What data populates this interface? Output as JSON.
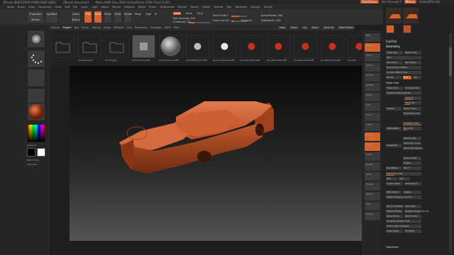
{
  "titlebar": {
    "app": "ZBrush 4R8[ZOSPB-PXNB-SNST-SKJD]",
    "doc": "ZBrush Document",
    "mem": "Mem 4996 Free 3941 ActivePoints 6784 Timer:0.011",
    "quicksave": "QuickSave",
    "seethrough": "See-through 0",
    "menus": "Menus",
    "defaultscript": "DefaultZScript"
  },
  "menubar": [
    "Alpha",
    "Brush",
    "Color",
    "Document",
    "Draw",
    "Edit",
    "File",
    "Layer",
    "Light",
    "Macro",
    "Marker",
    "Material",
    "Movie",
    "Picker",
    "Preferences",
    "Render",
    "Stencil",
    "Stroke",
    "Texture",
    "Tool",
    "Transform",
    "Zplugin",
    "Zscript"
  ],
  "toolrow": {
    "projection_master": "Projection Master",
    "lightbox": "LightBox",
    "quick_sketch": "Quick Sketch",
    "edit": "Edit",
    "draw": "Draw",
    "move": "Move",
    "scale": "Scale",
    "rotate": "Rotate",
    "mrgb": "Mrgb",
    "rgb": "Rgb",
    "m": "M",
    "zadd": "Zadd",
    "zsub": "Zsub",
    "zcut": "Zcut",
    "rgb_intensity": "Rgb Intensity 100",
    "z_intensity": "Z Intensity 25",
    "focal_shift": "Focal Shift 0",
    "draw_size": "Draw Size 64",
    "active_points": "ActivePoints: 558",
    "total_points": "TotalPoints: 558",
    "dynamic": "Dynamic"
  },
  "tabs": [
    "ZBrush",
    "Project",
    "Tool",
    "Brush",
    "Texture",
    "Alpha",
    "Material",
    "Grid",
    "Document",
    "Spotlight",
    "ZBSP",
    "Files"
  ],
  "tabs_active_index": 1,
  "tab_buttons": [
    "New",
    "Open",
    "Up",
    "Save",
    "Save As",
    "New Folder"
  ],
  "thumbs": [
    {
      "label": "",
      "kind": "folder"
    },
    {
      "label": "GameProjects",
      "kind": "folder"
    },
    {
      "label": "Homepage",
      "kind": "folder"
    },
    {
      "label": "DefaultCube.ZPR",
      "kind": "cube"
    },
    {
      "label": "DefaultSphere.ZPR",
      "kind": "sphere"
    },
    {
      "label": "DefaultSphere2.ZPR",
      "kind": "sphere-small"
    },
    {
      "label": "DynamicSphere.ZPR",
      "kind": "sphere-white"
    },
    {
      "label": "DynaMesh032.ZPR",
      "kind": "sphere-red"
    },
    {
      "label": "DynaMesh064.ZPR",
      "kind": "sphere-red"
    },
    {
      "label": "DynaMesh128.ZPR",
      "kind": "sphere-red"
    },
    {
      "label": "DynaMesh256.ZPR",
      "kind": "sphere-red"
    },
    {
      "label": "DynaMe",
      "kind": "sphere-red"
    }
  ],
  "leftpanel": {
    "switch_color": "SwitchColor",
    "gradient": "Gradient",
    "alternate": "Alternate"
  },
  "rtools": [
    "BPR",
    "SPix 3",
    "Scroll",
    "Zoom",
    "Actual",
    "AAHalf",
    "Persp",
    "Floor",
    "Local",
    "L.Sym",
    "Frame",
    "Move",
    "Scale",
    "Rotate",
    "PolyF",
    "Transp",
    "Ghost",
    "Solo",
    "Xpose"
  ],
  "rightpanel": {
    "subtool": "SubTool",
    "geometry": "Geometry",
    "lower_res": "Lower Res",
    "higher_res": "Higher Res",
    "sdiv": "SDiv",
    "del_lower": "Del Lower",
    "del_higher": "Del Higher",
    "reconstruct": "Reconstruct Subdiv",
    "convert_bpr": "Convert BPR To Geo",
    "divide": "Divide",
    "smt": "Smt",
    "suv": "Suv",
    "reuv": "ReUV",
    "edge_loop": "Edge Loop",
    "crease": "Crease",
    "shadowbox": "ShadowBox",
    "claypolish": "ClayPolish",
    "dynamesh": "DynaMesh",
    "zremesher": "ZRemesher",
    "modify_topology": "Modify Topology",
    "position": "Position",
    "size": "Size",
    "meshintegrity": "MeshIntegrity",
    "arraymesh": "ArrayMesh",
    "nanomesh": "NanoMesh",
    "layers": "Layers",
    "fibermesh": "FiberMesh",
    "geometry_hd": "Geometry HD",
    "preview": "Preview",
    "surface": "Surface",
    "deformation": "Deformation",
    "masking": "Masking",
    "visibility": "Visibility",
    "polygroups": "Polygroups",
    "contact": "Contact",
    "morph_target": "Morph Target",
    "polypaint": "Polypaint",
    "uv_map": "UV Map",
    "texture_map": "Texture Map",
    "displacement_map": "Displacement Map",
    "normal_map": "Normal Map",
    "vector_displacement": "Vector Displacement Map",
    "display_properties": "Display Properties",
    "unified_skin": "Unified Skin",
    "initialize": "Initialize",
    "import": "Import",
    "export": "Export",
    "coverage": "Coverage 100",
    "edge_loop_btn": "Edge Loop",
    "edgeloop_mask_border": "EdgeLoop Mask Border",
    "groups_loops": "GroupsLoops",
    "loops": "Loops 4",
    "polish": "Polish 30",
    "panel_loops": "Panel Loops",
    "thickness": "Thickness 0.02",
    "elevation": "Elevation 100",
    "bevel": "Bevel 25",
    "append": "Append",
    "inflate": "Inflate",
    "double": "Double",
    "polish_crisp": "Polish Crisp",
    "polish_group": "Polish By Group",
    "polish_features": "Polish By Features",
    "res": "Resolution 128",
    "blur": "Blur 2",
    "groups_split": "Groups Split",
    "project": "Project",
    "add": "Add",
    "sub": "Sub",
    "create_shell": "Create Shell",
    "thickness2": "Thickness 4",
    "zremesher_btn": "ZRemesher",
    "legacy": "Legacy",
    "freeze_border": "FreezeBorder",
    "freeze_groups": "FreezeGroups",
    "smooth_groups": "SmoothGroups",
    "keep_groups": "KeepGroups",
    "target_polycount": "Target Polygons Count 5",
    "half": "Half",
    "same": "Same",
    "double2": "Double",
    "adapt": "Adapt",
    "adaptive_size": "AdaptiveSize 50",
    "curves_strength": "Curves Strength 50",
    "use_polypaint": "Use Polypaint",
    "color": "Color",
    "mirror_weld": "Mirror And Weld",
    "delete_hidden": "Delete Hidden",
    "equalize": "Equalize Surface Area",
    "insert_mesh": "Insert Mesh",
    "spin_edge": "Spin Edge",
    "unweld_groups": "Unweld Groups Border",
    "close_holes": "Close Holes",
    "weld_points": "Weld Points",
    "align_edge": "Align Edge",
    "check_mesh": "Check Mesh Integrity",
    "fix_mesh": "Fix Mesh",
    "fibermesh_head": "FiberMesh"
  },
  "colors": {
    "accent": "#d4622e",
    "panel": "#262626",
    "button": "#3a3a3a",
    "model": "#c8562e"
  }
}
